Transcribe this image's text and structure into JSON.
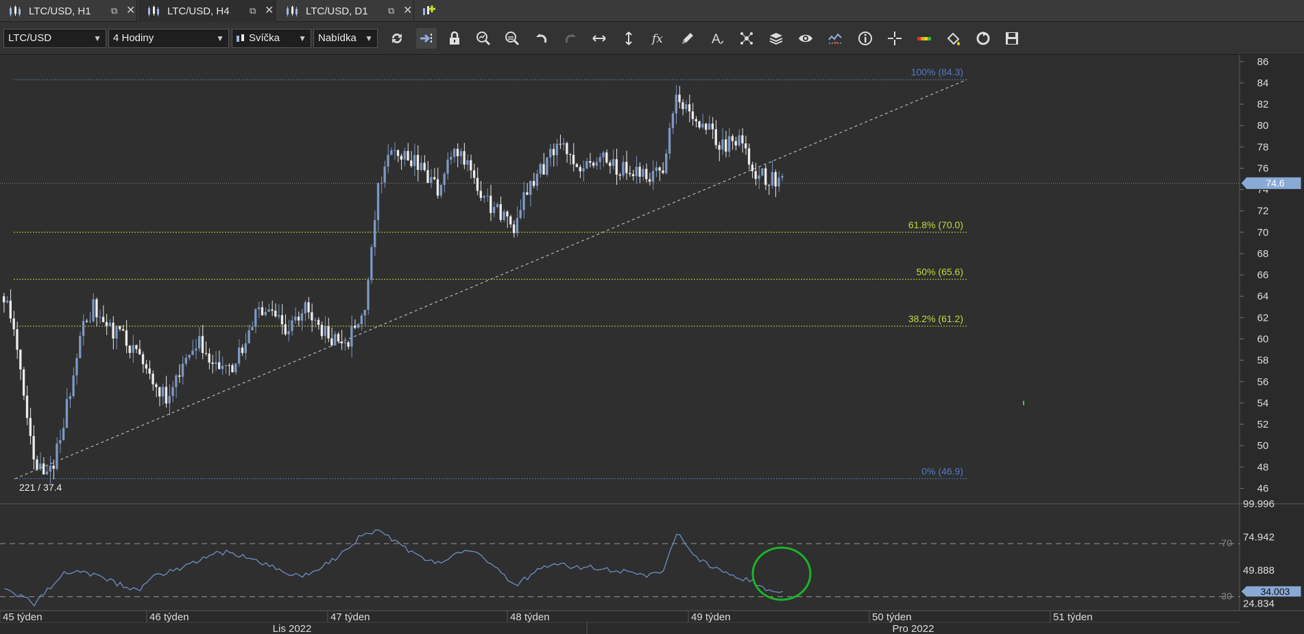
{
  "tabs": [
    {
      "label": "LTC/USD, H1",
      "active": false
    },
    {
      "label": "LTC/USD, H4",
      "active": true
    },
    {
      "label": "LTC/USD, D1",
      "active": false
    }
  ],
  "toolbar": {
    "symbol": "LTC/USD",
    "timeframe": "4 Hodiny",
    "chart_type": "Svíčka",
    "price_side": "Nabídka",
    "icons": [
      "refresh-icon",
      "autoscroll-icon",
      "lock-icon",
      "zoom-in-icon",
      "zoom-out-icon",
      "undo-icon",
      "redo-icon",
      "horizontal-resize-icon",
      "vertical-resize-icon",
      "function-icon",
      "pencil-icon",
      "text-icon",
      "pattern-icon",
      "layers-icon",
      "eye-icon",
      "indicator-icon",
      "info-icon",
      "crosshair-icon",
      "color-bar-icon",
      "fill-bucket-icon",
      "reset-icon",
      "save-icon"
    ]
  },
  "colors": {
    "candle_up": "#7d98c4",
    "candle_down": "#ececec",
    "fib_top": "#4f7cc8",
    "fib_mid": "#c6d93a",
    "rsi_line": "#6e8fc9",
    "price_tag": "#8aaad6",
    "highlight_circle": "#19b52a"
  },
  "chart_data": [
    {
      "type": "candlestick",
      "symbol": "LTC/USD",
      "timeframe": "H4",
      "y_axis": {
        "ticks": [
          86,
          84,
          82,
          80,
          78,
          76,
          74,
          72,
          70,
          68,
          66,
          64,
          62,
          60,
          58,
          56,
          54,
          52,
          50,
          48,
          46
        ],
        "ylim": [
          45,
          86.5
        ]
      },
      "current_price": "74.6",
      "cursor_readout": "221 / 37.4",
      "fibonacci": [
        {
          "label": "100% (84.3)",
          "value": 84.3
        },
        {
          "label": "61.8% (70.0)",
          "value": 70.0
        },
        {
          "label": "50% (65.6)",
          "value": 65.6
        },
        {
          "label": "38.2% (61.2)",
          "value": 61.2
        },
        {
          "label": "0% (46.9)",
          "value": 46.9
        }
      ],
      "trendline": {
        "from": {
          "week": "45 týden",
          "value": 46.9
        },
        "to": {
          "week": "50 týden",
          "value": 84.3
        }
      },
      "close_path": [
        64,
        59,
        48,
        47,
        52,
        60,
        63,
        61,
        60,
        58,
        56,
        54,
        58,
        60,
        58,
        57,
        59,
        63,
        62,
        61,
        63,
        61,
        60,
        60,
        62,
        74,
        78,
        77,
        76,
        74,
        78,
        76,
        73,
        72,
        70,
        74,
        76,
        78,
        77,
        76,
        77,
        76,
        76,
        75,
        76,
        83,
        81,
        80,
        78,
        79,
        76,
        75,
        74.6
      ],
      "candle_count": 236
    },
    {
      "type": "line",
      "indicator": "RSI",
      "y_axis": {
        "ticks": [
          "99.996",
          "74.942",
          "49.888",
          "24.834"
        ],
        "ylim": [
          20,
          100
        ]
      },
      "levels": [
        {
          "label": "70",
          "value": 70
        },
        {
          "label": "30",
          "value": 30
        }
      ],
      "current_value": "34.003",
      "values": [
        38,
        31,
        25,
        36,
        48,
        49,
        47,
        42,
        38,
        35,
        46,
        49,
        52,
        58,
        62,
        64,
        60,
        56,
        53,
        48,
        45,
        52,
        58,
        66,
        78,
        80,
        73,
        64,
        58,
        56,
        61,
        65,
        59,
        50,
        38,
        45,
        52,
        56,
        52,
        52,
        51,
        50,
        48,
        46,
        49,
        78,
        62,
        54,
        48,
        45,
        41,
        34,
        34.003
      ],
      "x_axis": {
        "ticks": [
          "45 týden",
          "46 týden",
          "47 týden",
          "48 týden",
          "49 týden",
          "50 týden",
          "51 týden"
        ],
        "months": [
          "Lis 2022",
          "Pro 2022"
        ]
      }
    }
  ]
}
